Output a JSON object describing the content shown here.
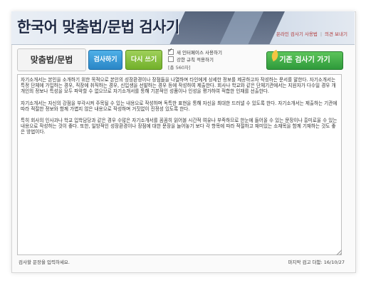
{
  "header": {
    "title": "한국어 맞춤법/문법 검사기",
    "links": [
      "온라인 검사기 사용법",
      "의견 보내기"
    ],
    "separator": "|"
  },
  "toolbar": {
    "mode_label": "맞춤법/문법",
    "check_button": "검사하기",
    "rewrite_button": "다시 쓰기",
    "options": [
      {
        "label": "새 인터페이스 사용하기",
        "checked": true
      },
      {
        "label": "강한 규칙 적용하기",
        "checked": false
      }
    ],
    "char_count": "[총 560자]",
    "classic_button": "기존 검사기 가기"
  },
  "editor": {
    "paragraphs": [
      "자기소개서는 본인을 소개하기 위한 목적으로 본인의 성장환경이나 장점들을 나열하며 타인에게 상세한 정보를 제공하고자 작성하는 문서를 말한다. 자기소개서는 특정 단체에 가입하는 경우, 직장에 취직하는 경우, 신입생을 선발하는 경우 등에 작성하여 제출한다. 회사나 학교와 같은 단체기관에서는 지원자가 다수일 경우 개개인의 정보나 특성을 모두 파악할 수 없으므로 자기소개서를 통해 기본적인 성품이나 인성을 평가하여 적합한 인재를 선출한다.",
      "자기소개서는 자신의 강점을 부각시켜 주목될 수 있는 내용으로 작성하며 독특한 표현을 통해 자신을 최대한 드러낼 수 있도록 한다. 자기소개서는 제출하는 기관에 따라 적절한 정보와 함께 가볍지 않은 내용으로 작성하며 거짓없이 진정성 있도록 한다.",
      "특히 회사의 인사과나 학교 입학담당과 같은 경우 수많은 자기소개서를 꼼꼼히 읽어볼 시간적 여유나 부족하므로 한눈에 들어올 수 있는 문장이나 흥미로울 수 있는 내용으로 작성하는 것이 좋다. 또한, 일방적인 성장환경이나 장점에 대한 문장을 늘어놓기 보다 각 항목에 따라 적절하고 재미있는 소재목을 함께 기재하는 것도 좋은 방법이다."
    ]
  },
  "footer": {
    "hint": "검사할 문장을 입력하세요.",
    "last_update": "마지막 검고 더함: 16/10/27"
  }
}
